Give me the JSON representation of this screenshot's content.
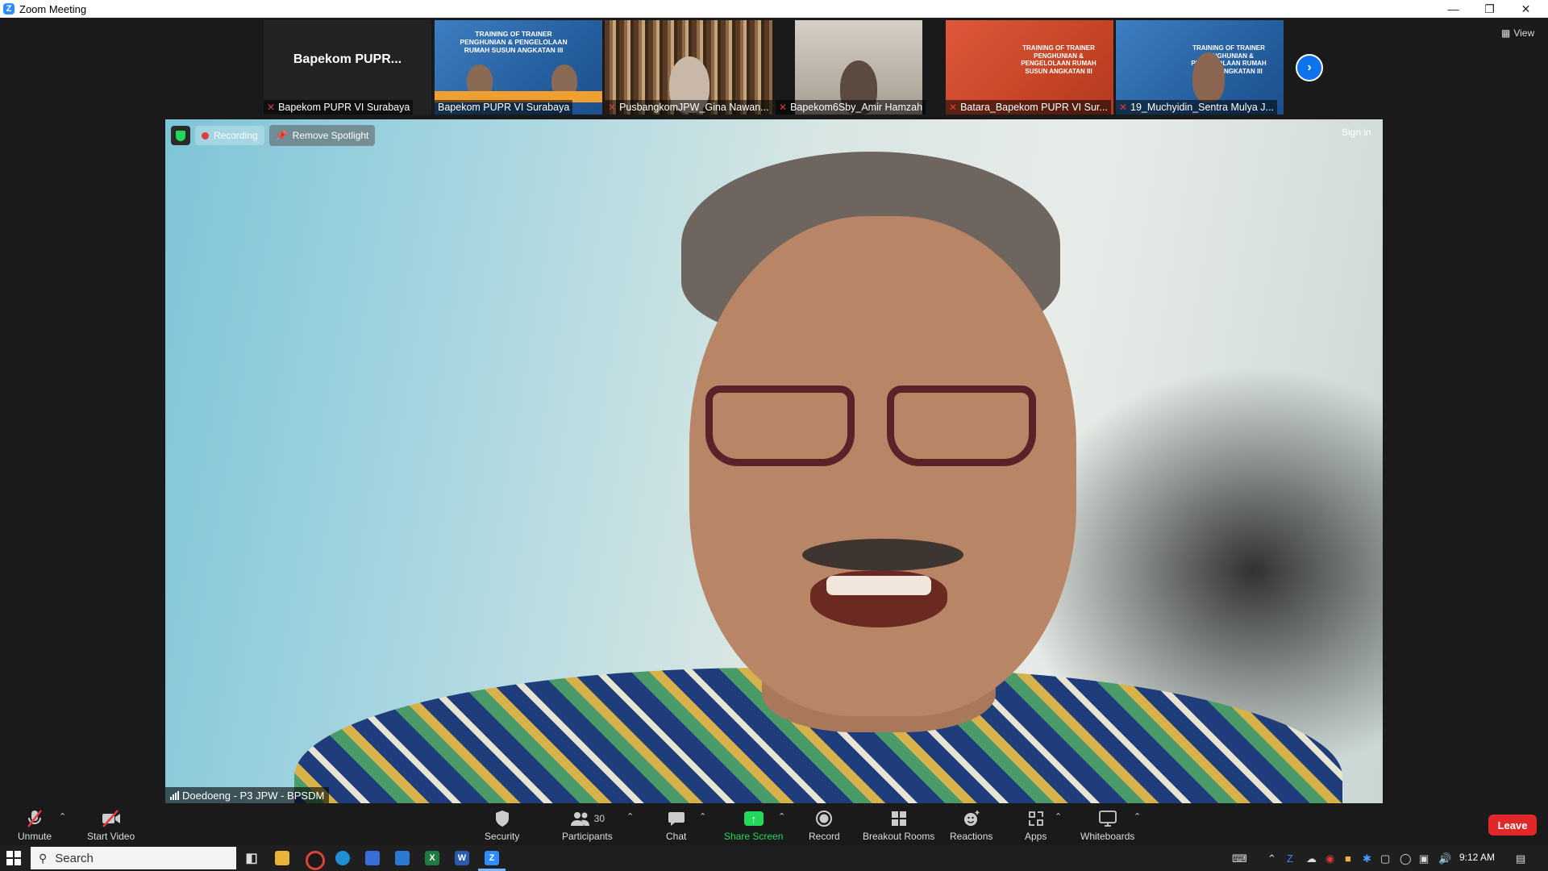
{
  "window": {
    "title": "Zoom Meeting"
  },
  "thumbnails": [
    {
      "big_name": "Bapekom  PUPR...",
      "name": "Bapekom PUPR VI Surabaya",
      "muted": true
    },
    {
      "name": "Bapekom PUPR VI Surabaya",
      "muted": false,
      "slide_text": "TRAINING OF TRAINER PENGHUNIAN & PENGELOLAAN RUMAH SUSUN ANGKATAN III"
    },
    {
      "name": "PusbangkomJPW_Gina Nawan...",
      "muted": true
    },
    {
      "name": "Bapekom6Sby_Amir Hamzah",
      "muted": true
    },
    {
      "name": "Batara_Bapekom PUPR VI Sur...",
      "muted": true,
      "slide_text": "TRAINING OF TRAINER PENGHUNIAN & PENGELOLAAN RUMAH SUSUN ANGKATAN III"
    },
    {
      "name": "19_Muchyidin_Sentra Mulya J...",
      "muted": true,
      "slide_text": "TRAINING OF TRAINER PENGHUNIAN & PENGELOLAAN RUMAH SUSUN ANGKATAN III"
    }
  ],
  "view_label": "View",
  "main_video": {
    "recording_label": "Recording",
    "remove_spotlight_label": "Remove Spotlight",
    "sign_in_label": "Sign in",
    "speaker_name": "Doedoeng - P3 JPW - BPSDM"
  },
  "toolbar": {
    "unmute": "Unmute",
    "start_video": "Start Video",
    "security": "Security",
    "participants": "Participants",
    "participants_count": "30",
    "chat": "Chat",
    "share_screen": "Share Screen",
    "record": "Record",
    "breakout_rooms": "Breakout Rooms",
    "reactions": "Reactions",
    "apps": "Apps",
    "whiteboards": "Whiteboards",
    "leave": "Leave"
  },
  "taskbar": {
    "search_placeholder": "Search",
    "clock": "9:12 AM"
  },
  "colors": {
    "zoom_blue": "#2d8cff",
    "share_green": "#23d959",
    "leave_red": "#e02828"
  }
}
